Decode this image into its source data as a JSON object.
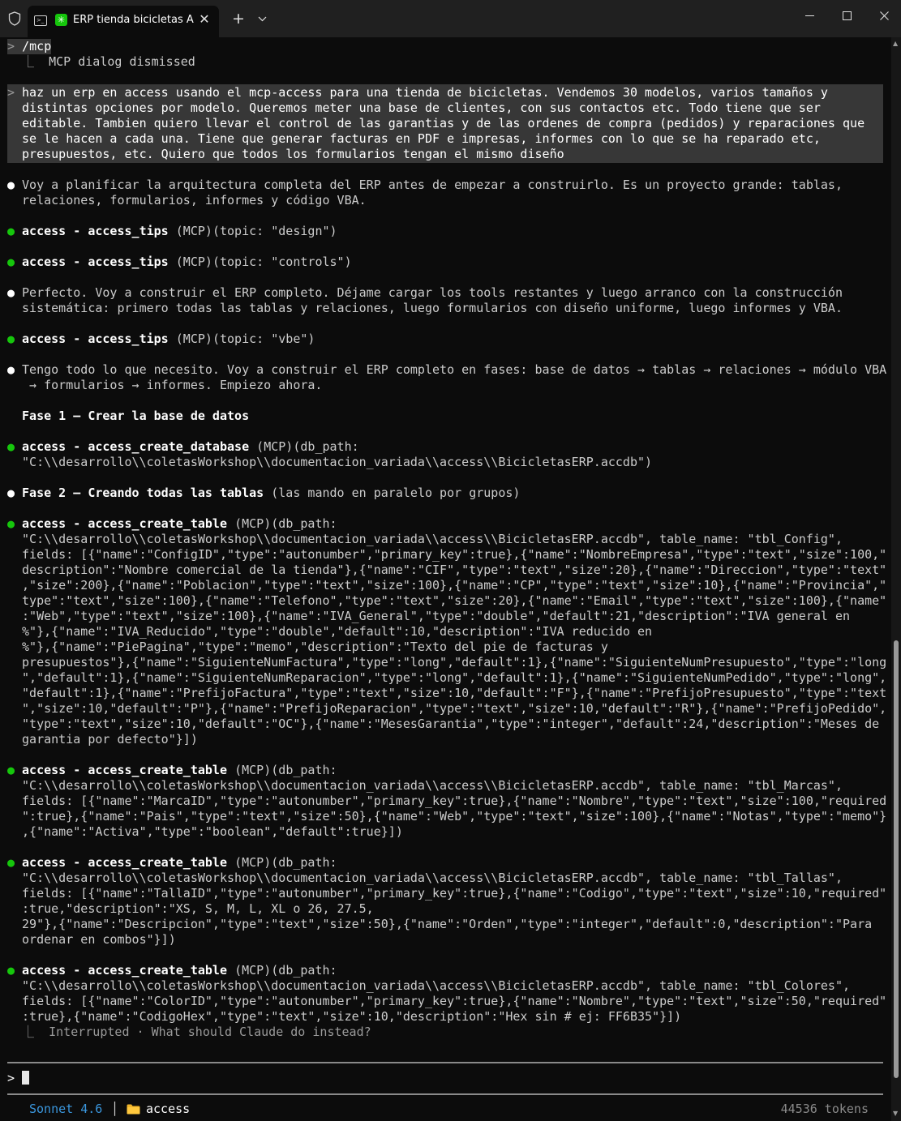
{
  "window": {
    "tab_title": "ERP tienda bicicletas A",
    "tab_close": "✕",
    "new_tab": "+",
    "dropdown": "⌄"
  },
  "terminal": {
    "command_prompt": ">",
    "command": "/mcp",
    "command_result_marker": "⎿",
    "command_result": "MCP dialog dismissed",
    "user_prompt_lines": [
      "haz un erp en access usando el mcp-access para una tienda de bicicletas. Vendemos 30 modelos, varios tamaños y",
      "distintas opciones por modelo. Queremos meter una base de clientes, con sus contactos etc. Todo tiene que ser",
      "editable. Tambien quiero llevar el control de las garantias y de las ordenes de compra (pedidos) y reparaciones que",
      "se le hacen a cada una. Tiene que generar facturas en PDF e impresas, informes con lo que se ha reparado etc,",
      "presupuestos, etc. Quiero que todos los formularios tengan el mismo diseño"
    ],
    "bullet": "●",
    "msg1": [
      "Voy a planificar la arquitectura completa del ERP antes de empezar a construirlo. Es un proyecto grande: tablas,",
      "relaciones, formularios, informes y código VBA."
    ],
    "tool_tips_design": {
      "server": "access - access_tips",
      "tag": "(MCP)",
      "args": "(topic: \"design\")"
    },
    "tool_tips_controls": {
      "server": "access - access_tips",
      "tag": "(MCP)",
      "args": "(topic: \"controls\")"
    },
    "msg2": [
      "Perfecto. Voy a construir el ERP completo. Déjame cargar los tools restantes y luego arranco con la construcción",
      "sistemática: primero todas las tablas y relaciones, luego formularios con diseño uniforme, luego informes y VBA."
    ],
    "tool_tips_vbe": {
      "server": "access - access_tips",
      "tag": "(MCP)",
      "args": "(topic: \"vbe\")"
    },
    "msg3": [
      "Tengo todo lo que necesito. Voy a construir el ERP completo en fases: base de datos → tablas → relaciones → módulo VBA",
      " → formularios → informes. Empiezo ahora."
    ],
    "phase1_title": "Fase 1 — Crear la base de datos",
    "tool_create_db": {
      "server": "access - access_create_database",
      "tag": "(MCP)",
      "args_lines": [
        "(db_path:",
        "\"C:\\\\desarrollo\\\\coletasWorkshop\\\\documentacion_variada\\\\access\\\\BicicletasERP.accdb\")"
      ]
    },
    "phase2_title": "Fase 2 — Creando todas las tablas",
    "phase2_note": " (las mando en paralelo por grupos)",
    "tool_config": {
      "server": "access - access_create_table",
      "tag": "(MCP)",
      "args_lines": [
        "(db_path:",
        "\"C:\\\\desarrollo\\\\coletasWorkshop\\\\documentacion_variada\\\\access\\\\BicicletasERP.accdb\", table_name: \"tbl_Config\",",
        "fields: [{\"name\":\"ConfigID\",\"type\":\"autonumber\",\"primary_key\":true},{\"name\":\"NombreEmpresa\",\"type\":\"text\",\"size\":100,\"",
        "description\":\"Nombre comercial de la tienda\"},{\"name\":\"CIF\",\"type\":\"text\",\"size\":20},{\"name\":\"Direccion\",\"type\":\"text\"",
        ",\"size\":200},{\"name\":\"Poblacion\",\"type\":\"text\",\"size\":100},{\"name\":\"CP\",\"type\":\"text\",\"size\":10},{\"name\":\"Provincia\",\"",
        "type\":\"text\",\"size\":100},{\"name\":\"Telefono\",\"type\":\"text\",\"size\":20},{\"name\":\"Email\",\"type\":\"text\",\"size\":100},{\"name\"",
        ":\"Web\",\"type\":\"text\",\"size\":100},{\"name\":\"IVA_General\",\"type\":\"double\",\"default\":21,\"description\":\"IVA general en",
        "%\"},{\"name\":\"IVA_Reducido\",\"type\":\"double\",\"default\":10,\"description\":\"IVA reducido en",
        "%\"},{\"name\":\"PiePagina\",\"type\":\"memo\",\"description\":\"Texto del pie de facturas y",
        "presupuestos\"},{\"name\":\"SiguienteNumFactura\",\"type\":\"long\",\"default\":1},{\"name\":\"SiguienteNumPresupuesto\",\"type\":\"long",
        "\",\"default\":1},{\"name\":\"SiguienteNumReparacion\",\"type\":\"long\",\"default\":1},{\"name\":\"SiguienteNumPedido\",\"type\":\"long\",",
        "\"default\":1},{\"name\":\"PrefijoFactura\",\"type\":\"text\",\"size\":10,\"default\":\"F\"},{\"name\":\"PrefijoPresupuesto\",\"type\":\"text",
        "\",\"size\":10,\"default\":\"P\"},{\"name\":\"PrefijoReparacion\",\"type\":\"text\",\"size\":10,\"default\":\"R\"},{\"name\":\"PrefijoPedido\",",
        "\"type\":\"text\",\"size\":10,\"default\":\"OC\"},{\"name\":\"MesesGarantia\",\"type\":\"integer\",\"default\":24,\"description\":\"Meses de",
        "garantia por defecto\"}])"
      ]
    },
    "tool_marcas": {
      "server": "access - access_create_table",
      "tag": "(MCP)",
      "args_lines": [
        "(db_path:",
        "\"C:\\\\desarrollo\\\\coletasWorkshop\\\\documentacion_variada\\\\access\\\\BicicletasERP.accdb\", table_name: \"tbl_Marcas\",",
        "fields: [{\"name\":\"MarcaID\",\"type\":\"autonumber\",\"primary_key\":true},{\"name\":\"Nombre\",\"type\":\"text\",\"size\":100,\"required",
        "\":true},{\"name\":\"Pais\",\"type\":\"text\",\"size\":50},{\"name\":\"Web\",\"type\":\"text\",\"size\":100},{\"name\":\"Notas\",\"type\":\"memo\"}",
        ",{\"name\":\"Activa\",\"type\":\"boolean\",\"default\":true}])"
      ]
    },
    "tool_tallas": {
      "server": "access - access_create_table",
      "tag": "(MCP)",
      "args_lines": [
        "(db_path:",
        "\"C:\\\\desarrollo\\\\coletasWorkshop\\\\documentacion_variada\\\\access\\\\BicicletasERP.accdb\", table_name: \"tbl_Tallas\",",
        "fields: [{\"name\":\"TallaID\",\"type\":\"autonumber\",\"primary_key\":true},{\"name\":\"Codigo\",\"type\":\"text\",\"size\":10,\"required\"",
        ":true,\"description\":\"XS, S, M, L, XL o 26, 27.5,",
        "29\"},{\"name\":\"Descripcion\",\"type\":\"text\",\"size\":50},{\"name\":\"Orden\",\"type\":\"integer\",\"default\":0,\"description\":\"Para",
        "ordenar en combos\"}])"
      ]
    },
    "tool_colores": {
      "server": "access - access_create_table",
      "tag": "(MCP)",
      "args_lines": [
        "(db_path:",
        "\"C:\\\\desarrollo\\\\coletasWorkshop\\\\documentacion_variada\\\\access\\\\BicicletasERP.accdb\", table_name: \"tbl_Colores\",",
        "fields: [{\"name\":\"ColorID\",\"type\":\"autonumber\",\"primary_key\":true},{\"name\":\"Nombre\",\"type\":\"text\",\"size\":50,\"required\"",
        ":true},{\"name\":\"CodigoHex\",\"type\":\"text\",\"size\":10,\"description\":\"Hex sin # ej: FF6B35\"}])"
      ]
    },
    "interrupted": "Interrupted · What should Claude do instead?",
    "input_prompt": ">"
  },
  "status_bar": {
    "model": "Sonnet 4.6",
    "separator": "│",
    "folder": "access",
    "tokens": "44536 tokens"
  },
  "colors": {
    "background": "#0c0c0c",
    "bullet_green": "#16c60c",
    "model_blue": "#3a96dd",
    "highlight": "#373737"
  }
}
